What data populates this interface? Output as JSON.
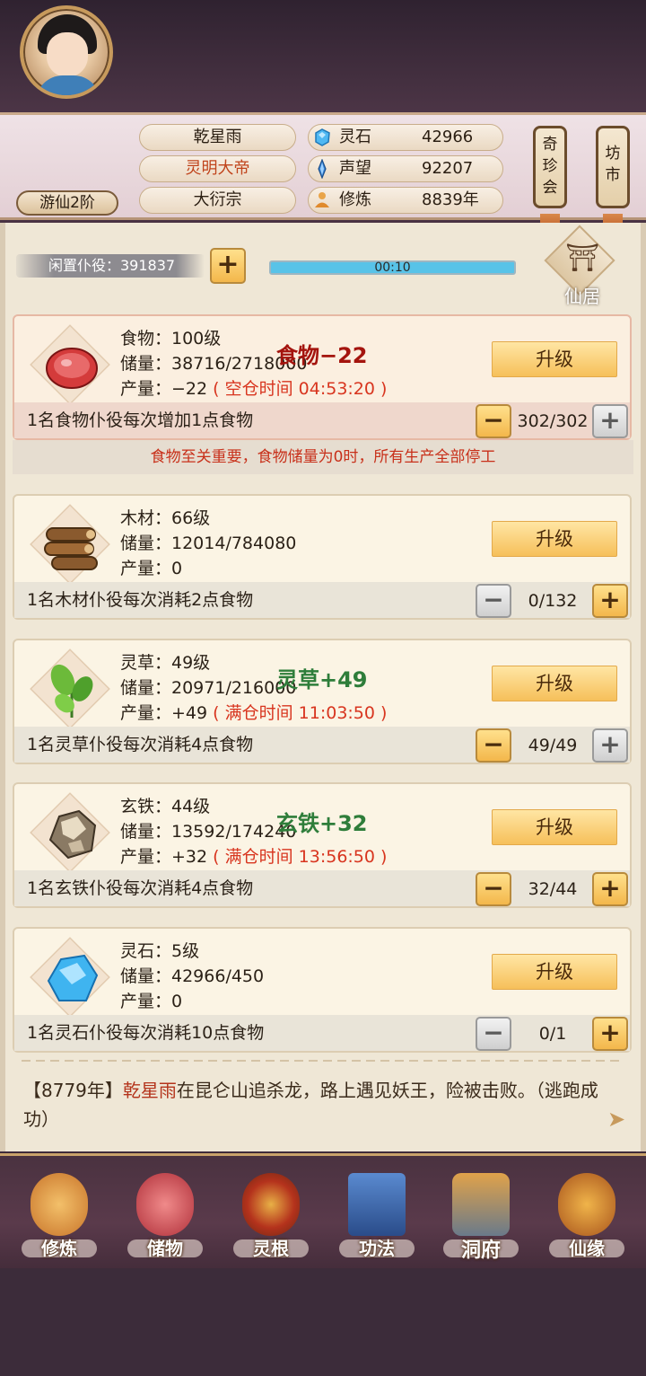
{
  "header": {
    "rank": "游仙2阶",
    "names": [
      "乾星雨",
      "灵明大帝",
      "大衍宗"
    ],
    "stats": [
      {
        "icon": "spirit-stone-icon",
        "label": "灵石",
        "value": "42966"
      },
      {
        "icon": "prestige-icon",
        "label": "声望",
        "value": "92207"
      },
      {
        "icon": "cultivation-icon",
        "label": "修炼",
        "value": "8839年"
      }
    ],
    "side_tabs": [
      {
        "label": "奇珍会",
        "chars": [
          "奇",
          "珍",
          "会"
        ]
      },
      {
        "label": "坊市",
        "chars": [
          "坊",
          "市"
        ]
      }
    ]
  },
  "idle": {
    "label": "闲置仆役：391837",
    "timer": "00:10",
    "xianju_label": "仙居"
  },
  "resources": [
    {
      "id": "food",
      "icon": "meat-icon",
      "level": "食物：100级",
      "storage": "储量：38716/2718000",
      "output": "产量：−22",
      "output_note": "( 空仓时间 04:53:20 )",
      "float": "食物−22",
      "upgrade": "升级",
      "desc": "1名食物仆役每次增加1点食物",
      "count": "302/302"
    },
    {
      "id": "wood",
      "icon": "logs-icon",
      "level": "木材：66级",
      "storage": "储量：12014/784080",
      "output": "产量：0",
      "output_note": "",
      "float": "",
      "upgrade": "升级",
      "desc": "1名木材仆役每次消耗2点食物",
      "count": "0/132"
    },
    {
      "id": "herb",
      "icon": "herb-icon",
      "level": "灵草：49级",
      "storage": "储量：20971/216000",
      "output": "产量：+49",
      "output_note": "( 满仓时间 11:03:50 )",
      "float": "灵草+49",
      "upgrade": "升级",
      "desc": "1名灵草仆役每次消耗4点食物",
      "count": "49/49"
    },
    {
      "id": "iron",
      "icon": "iron-ore-icon",
      "level": "玄铁：44级",
      "storage": "储量：13592/174240",
      "output": "产量：+32",
      "output_note": "( 满仓时间 13:56:50 )",
      "float": "玄铁+32",
      "upgrade": "升级",
      "desc": "1名玄铁仆役每次消耗4点食物",
      "count": "32/44"
    },
    {
      "id": "stone",
      "icon": "spirit-crystal-icon",
      "level": "灵石：5级",
      "storage": "储量：42966/450",
      "output": "产量：0",
      "output_note": "",
      "float": "",
      "upgrade": "升级",
      "desc": "1名灵石仆役每次消耗10点食物",
      "count": "0/1"
    }
  ],
  "warning": "食物至关重要，食物储量为0时，所有生产全部停工",
  "log": {
    "year": "【8779年】",
    "name": "乾星雨",
    "text": "在昆仑山追杀龙，路上遇见妖王，险被击败。（逃跑成功）"
  },
  "nav": [
    {
      "label": "修炼",
      "icon": "meditation-icon"
    },
    {
      "label": "储物",
      "icon": "bag-icon"
    },
    {
      "label": "灵根",
      "icon": "spirit-root-icon"
    },
    {
      "label": "功法",
      "icon": "book-icon"
    },
    {
      "label": "洞府",
      "icon": "cave-dwelling-icon"
    },
    {
      "label": "仙缘",
      "icon": "gourd-icon"
    }
  ],
  "colors": {
    "accent_gold": "#f6c05a",
    "alert_red": "#d8351f",
    "positive_green": "#2e7d3a",
    "progress_blue": "#58c3e8"
  }
}
